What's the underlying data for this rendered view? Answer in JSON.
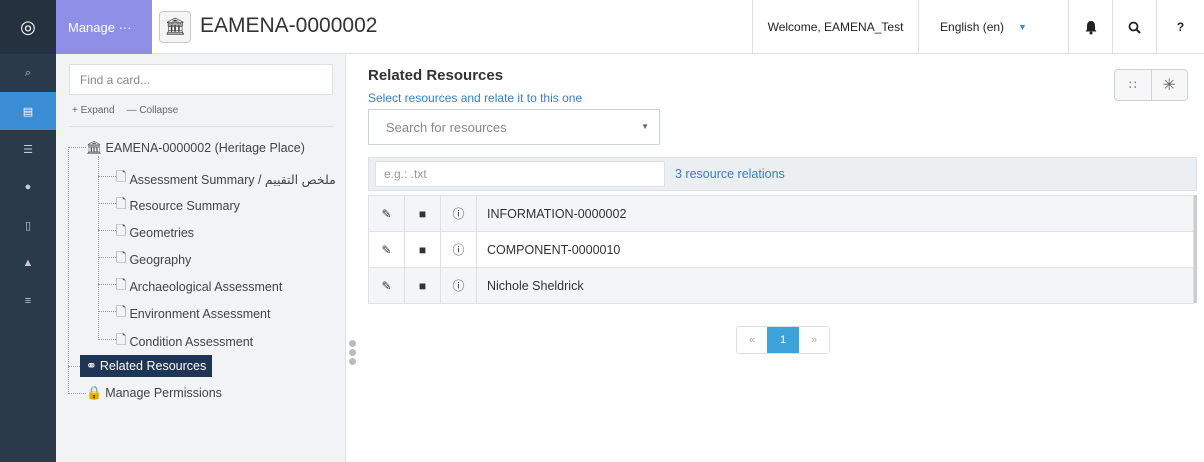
{
  "rail": {
    "items": [
      {
        "icon": "search-icon",
        "glyph": "⌕"
      },
      {
        "icon": "book-icon",
        "glyph": "▤"
      },
      {
        "icon": "list-icon",
        "glyph": "☰"
      },
      {
        "icon": "globe-icon",
        "glyph": "●"
      },
      {
        "icon": "clipboard-icon",
        "glyph": "▯"
      },
      {
        "icon": "user-icon",
        "glyph": "▲"
      },
      {
        "icon": "menu-icon",
        "glyph": "≡"
      }
    ]
  },
  "topbar": {
    "manage_label": "Manage ···",
    "resource_icon": "🏛",
    "resource_title": "EAMENA-0000002",
    "welcome": "Welcome, EAMENA_Test",
    "language": "English (en)",
    "language_caret": "▼",
    "bell_glyph": "▲",
    "search_glyph": "⌕",
    "help_glyph": "?"
  },
  "tree": {
    "find_placeholder": "Find a card...",
    "expand_label": "+ Expand",
    "collapse_label": "— Collapse",
    "root": {
      "label": "EAMENA-0000002 (Heritage Place)",
      "icon": "🏛"
    },
    "cards": [
      {
        "label": "Assessment Summary / ملخص التقييم",
        "icon": "🗋"
      },
      {
        "label": "Resource Summary",
        "icon": "🗋"
      },
      {
        "label": "Geometries",
        "icon": "🗋"
      },
      {
        "label": "Geography",
        "icon": "🗋"
      },
      {
        "label": "Archaeological Assessment",
        "icon": "🗋"
      },
      {
        "label": "Environment Assessment",
        "icon": "🗋"
      },
      {
        "label": "Condition Assessment",
        "icon": "🗋"
      }
    ],
    "related": {
      "label": "Related Resources",
      "icon": "⚭"
    },
    "permissions": {
      "label": "Manage Permissions",
      "icon": "🔒"
    }
  },
  "main": {
    "title": "Related Resources",
    "subtitle": "Select resources and relate it to this one",
    "search_placeholder": "Search for resources",
    "filter_placeholder": "e.g.: .txt",
    "relation_count": "3 resource relations",
    "rows": [
      {
        "name": "INFORMATION-0000002"
      },
      {
        "name": "COMPONENT-0000010"
      },
      {
        "name": "Nichole Sheldrick"
      }
    ],
    "row_icons": {
      "edit": "✎",
      "delete": "■",
      "info": "ⓘ"
    },
    "view_buttons": [
      "∷",
      "✳"
    ],
    "pager": {
      "prev": "«",
      "current": "1",
      "next": "»"
    }
  },
  "colors": {
    "rail_bg": "#2a3a4a",
    "rail_active": "#3b8dd6",
    "manage_bg": "#8f8fe8",
    "selected_node_bg": "#1f3555",
    "link_blue": "#3b7cc0",
    "pager_active": "#3ba3d9"
  }
}
